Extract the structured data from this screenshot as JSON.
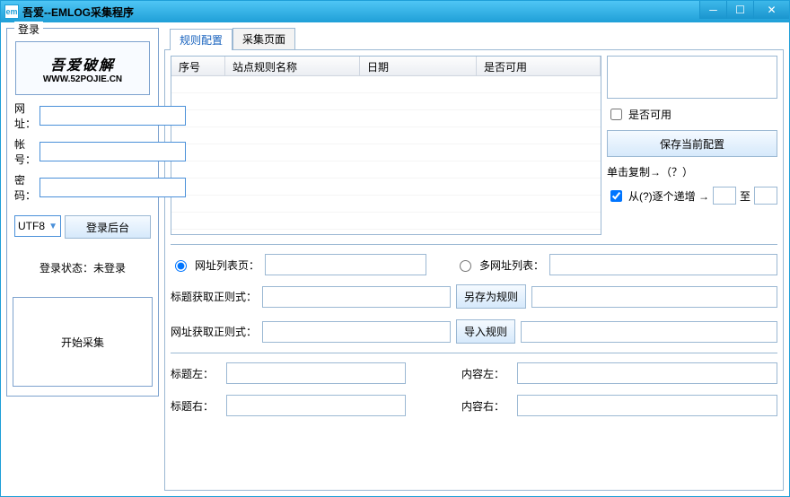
{
  "window": {
    "icon": "em",
    "title": "吾爱--EMLOG采集程序"
  },
  "login": {
    "legend": "登录",
    "logo_text": "吾爱破解",
    "logo_sub": "WWW.52POJIE.CN",
    "url_label": "网址：",
    "url_value": "",
    "user_label": "帐号：",
    "user_value": "",
    "pass_label": "密码：",
    "pass_value": "",
    "encoding": "UTF8",
    "login_button": "登录后台",
    "status_label": "登录状态：",
    "status_value": "未登录",
    "start_button": "开始采集"
  },
  "tabs": {
    "rule": "规则配置",
    "collect": "采集页面"
  },
  "grid": {
    "col1": "序号",
    "col2": "站点规则名称",
    "col3": "日期",
    "col4": "是否可用"
  },
  "right": {
    "usable": "是否可用",
    "save_config": "保存当前配置",
    "copy_hint": "单击复制→（？）",
    "inc_label": "从(?)逐个递增 →",
    "to": "至"
  },
  "mid": {
    "url_list_radio": "网址列表页：",
    "multi_url_radio": "多网址列表："
  },
  "rules": {
    "title_regex": "标题获取正则式：",
    "url_regex": "网址获取正则式：",
    "save_as_rule": "另存为规则",
    "import_rule": "导入规则"
  },
  "bounds": {
    "title_left": "标题左：",
    "title_right": "标题右：",
    "content_left": "内容左：",
    "content_right": "内容右："
  }
}
